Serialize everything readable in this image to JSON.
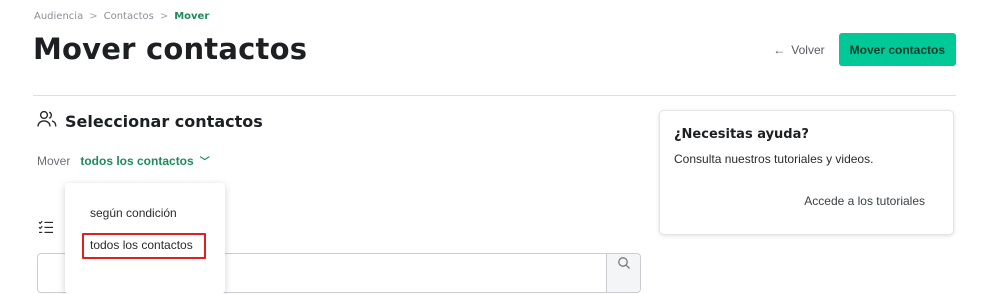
{
  "breadcrumb": {
    "items": [
      "Audiencia",
      "Contactos"
    ],
    "separator": ">",
    "current": "Mover"
  },
  "header": {
    "title": "Mover contactos",
    "back_arrow": "←",
    "back_label": "Volver",
    "primary_button": "Mover contactos"
  },
  "section": {
    "icon": "users-icon",
    "title": "Seleccionar contactos"
  },
  "move_row": {
    "prefix": "Mover",
    "selected": "todos los contactos",
    "chevron": "﹀"
  },
  "dropdown": {
    "options": [
      "según condición",
      "todos los contactos"
    ],
    "highlighted_index": 1
  },
  "input": {
    "search_icon": "search-icon"
  },
  "help": {
    "title": "¿Necesitas ayuda?",
    "description": "Consulta nuestros tutoriales y videos.",
    "link": "Accede a los tutoriales"
  },
  "colors": {
    "accent": "#00c896",
    "accent_text": "#1f8a5c",
    "highlight": "#e02020"
  }
}
